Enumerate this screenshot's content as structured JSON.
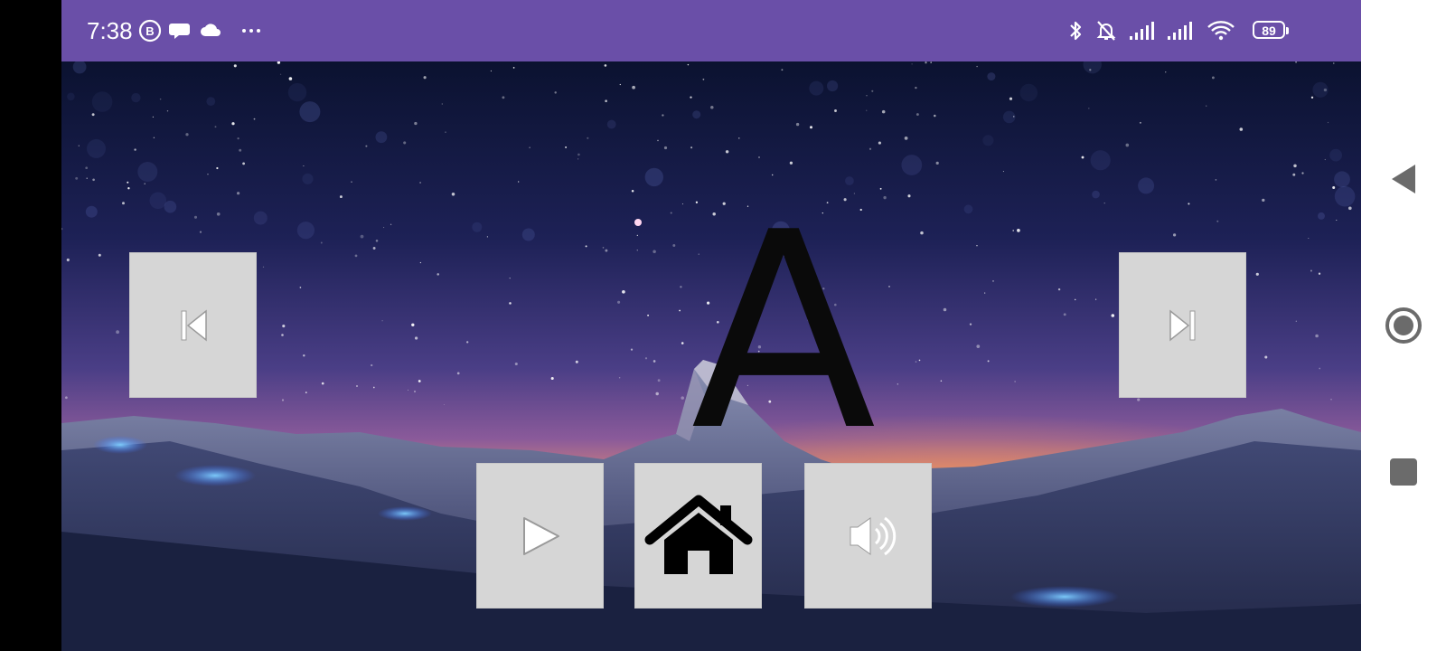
{
  "status_bar": {
    "time": "7:38",
    "battery_level": "89",
    "background_color": "#6a4fa8",
    "left_icons": [
      "b-badge-icon",
      "chat-bubble-icon",
      "cloud-icon",
      "more-dots-icon"
    ],
    "right_icons": [
      "bluetooth-icon",
      "bell-muted-icon",
      "signal-icon",
      "signal-icon",
      "wifi-icon",
      "battery-icon"
    ]
  },
  "main": {
    "letter": "A",
    "background": "starry-night-mountain",
    "controls": {
      "previous": {
        "icon": "skip-previous-icon"
      },
      "next": {
        "icon": "skip-next-icon"
      },
      "play": {
        "icon": "play-icon"
      },
      "home": {
        "icon": "home-icon"
      },
      "sound": {
        "icon": "speaker-icon"
      }
    },
    "button_color": "#d6d6d6"
  },
  "nav_bar": {
    "buttons": [
      "back-triangle-icon",
      "home-circle-icon",
      "recents-square-icon"
    ]
  }
}
